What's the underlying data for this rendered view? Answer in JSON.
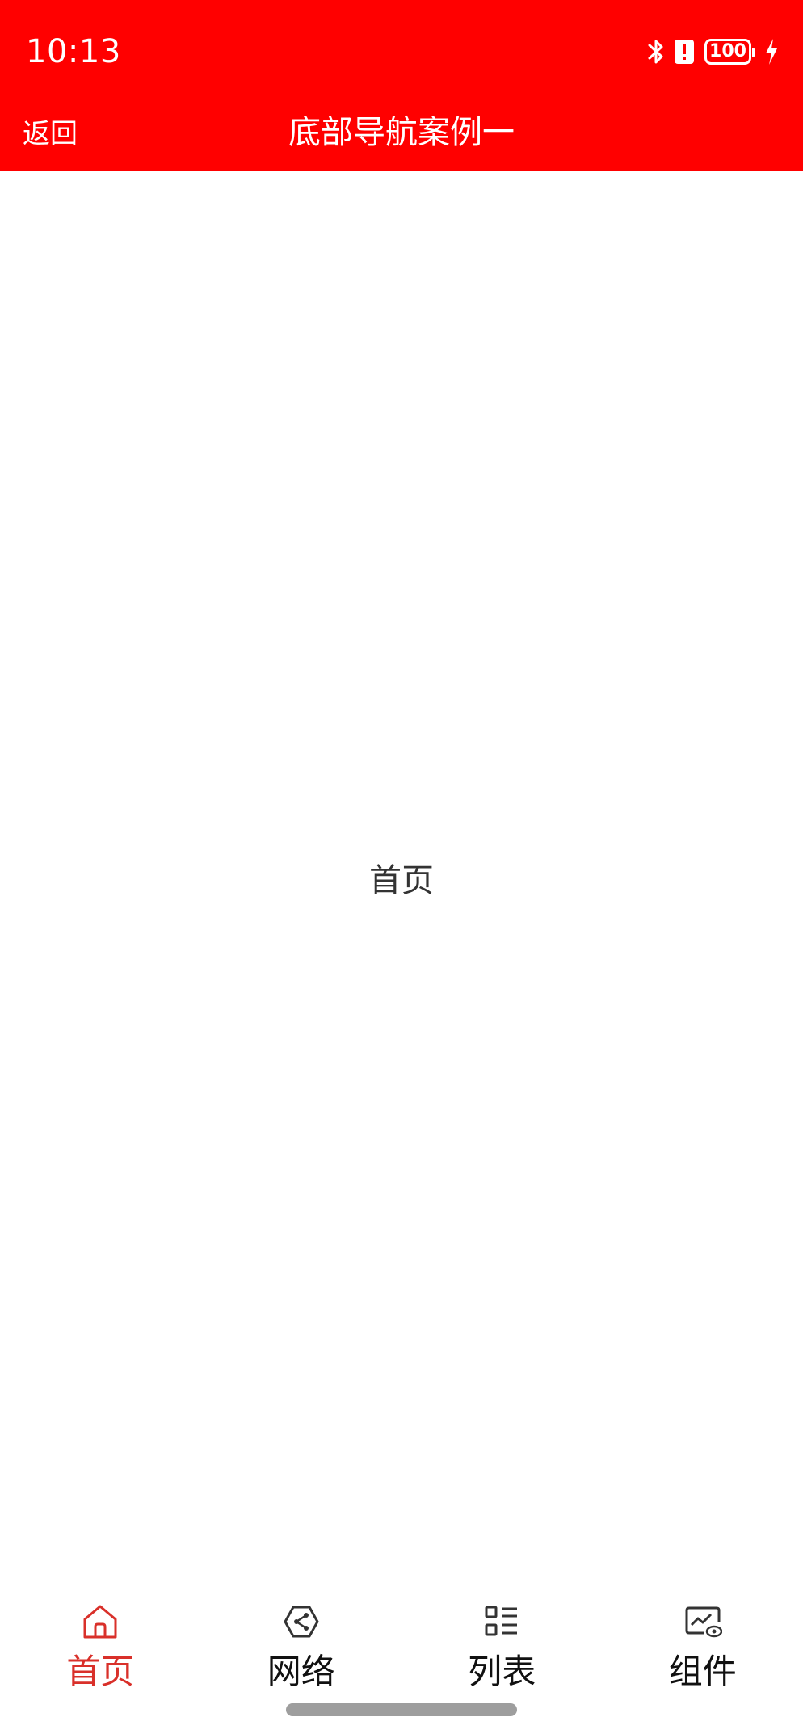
{
  "status_bar": {
    "time": "10:13",
    "battery_level": "100",
    "icons": [
      "bluetooth-icon",
      "alert-icon",
      "battery-icon",
      "charging-icon"
    ]
  },
  "title_bar": {
    "back_label": "返回",
    "title": "底部导航案例一"
  },
  "content": {
    "label": "首页"
  },
  "tabs": [
    {
      "label": "首页",
      "icon": "home-icon",
      "active": true
    },
    {
      "label": "网络",
      "icon": "network-icon",
      "active": false
    },
    {
      "label": "列表",
      "icon": "list-icon",
      "active": false
    },
    {
      "label": "组件",
      "icon": "component-icon",
      "active": false
    }
  ],
  "colors": {
    "header_bg": "#ff0000",
    "active_tab": "#d9302a",
    "inactive_tab": "#111111"
  }
}
